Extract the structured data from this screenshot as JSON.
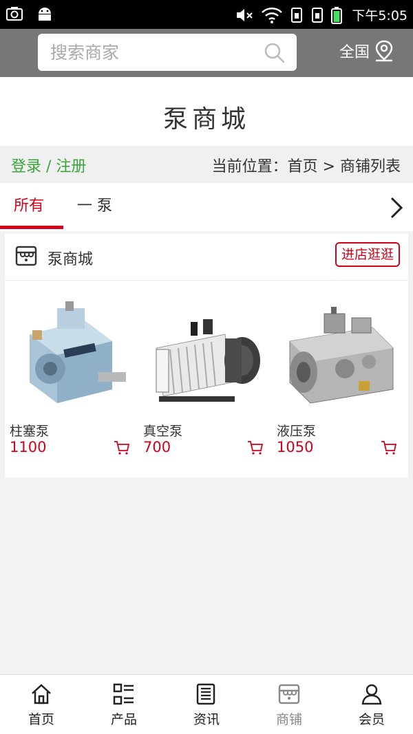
{
  "status_bar": {
    "time": "下午5:05"
  },
  "header": {
    "search_placeholder": "搜索商家",
    "region": "全国"
  },
  "site_title": "泵商城",
  "breadcrumb": {
    "login": "登录 / 注册",
    "location": "当前位置：首页 > 商铺列表"
  },
  "tabs": [
    {
      "label": "所有",
      "active": true
    },
    {
      "label": "一 泵",
      "active": false
    }
  ],
  "shop": {
    "name": "泵商城",
    "visit_label": "进店逛逛",
    "products": [
      {
        "name": "柱塞泵",
        "price": "1100"
      },
      {
        "name": "真空泵",
        "price": "700"
      },
      {
        "name": "液压泵",
        "price": "1050"
      }
    ]
  },
  "bottom_nav": [
    {
      "label": "首页",
      "icon": "home-icon"
    },
    {
      "label": "产品",
      "icon": "list-icon"
    },
    {
      "label": "资讯",
      "icon": "news-icon"
    },
    {
      "label": "商铺",
      "icon": "store-icon",
      "active": true
    },
    {
      "label": "会员",
      "icon": "user-icon"
    }
  ],
  "colors": {
    "accent": "#d0021b",
    "login_green": "#3aa53a",
    "header_bg": "#777777"
  }
}
